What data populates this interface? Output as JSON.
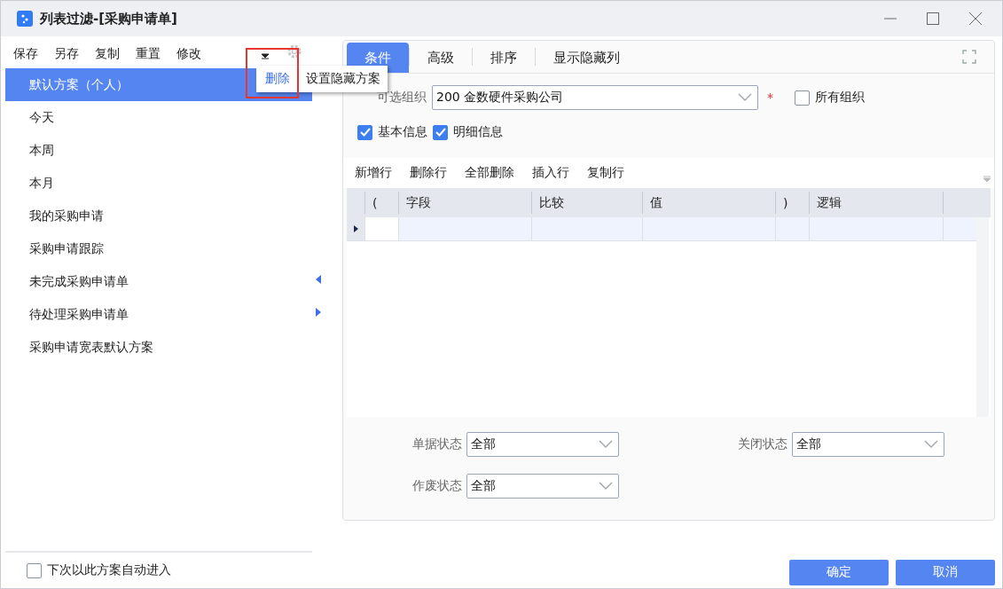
{
  "window": {
    "title": "列表过滤-[采购申请单]"
  },
  "toolbar": [
    "保存",
    "另存",
    "复制",
    "重置",
    "修改"
  ],
  "settings_menu": {
    "highlighted": true,
    "items": [
      {
        "label": "删除",
        "selected": true
      },
      {
        "label": "设置隐藏方案",
        "selected": false
      }
    ]
  },
  "schemes": [
    {
      "label": "默认方案（个人）",
      "selected": true
    },
    {
      "label": "今天",
      "selected": false
    },
    {
      "label": "本周",
      "selected": false
    },
    {
      "label": "本月",
      "selected": false
    },
    {
      "label": "我的采购申请",
      "selected": false
    },
    {
      "label": "采购申请跟踪",
      "selected": false
    },
    {
      "label": "未完成采购申请单",
      "selected": false
    },
    {
      "label": "待处理采购申请单",
      "selected": false
    },
    {
      "label": "采购申请宽表默认方案",
      "selected": false
    }
  ],
  "auto_enter": {
    "label": "下次以此方案自动进入",
    "checked": false
  },
  "tabs": [
    {
      "label": "条件",
      "selected": true
    },
    {
      "label": "高级",
      "selected": false
    },
    {
      "label": "排序",
      "selected": false
    },
    {
      "label": "显示隐藏列",
      "selected": false
    }
  ],
  "org": {
    "label": "可选组织",
    "value": "200 金数硬件采购公司",
    "required_mark": "*"
  },
  "all_orgs": {
    "label": "所有组织",
    "checked": false
  },
  "info_checks": [
    {
      "label": "基本信息",
      "checked": true
    },
    {
      "label": "明细信息",
      "checked": true
    }
  ],
  "grid_toolbar": [
    "新增行",
    "删除行",
    "全部删除",
    "插入行",
    "复制行"
  ],
  "grid": {
    "columns": [
      "(",
      "字段",
      "比较",
      "值",
      ")",
      "逻辑"
    ],
    "rows": [
      {
        "current": true
      }
    ]
  },
  "status_fields": [
    {
      "label": "单据状态",
      "value": "全部"
    },
    {
      "label": "关闭状态",
      "value": "全部"
    },
    {
      "label": "作废状态",
      "value": "全部"
    }
  ],
  "buttons": [
    "确定",
    "取消"
  ]
}
